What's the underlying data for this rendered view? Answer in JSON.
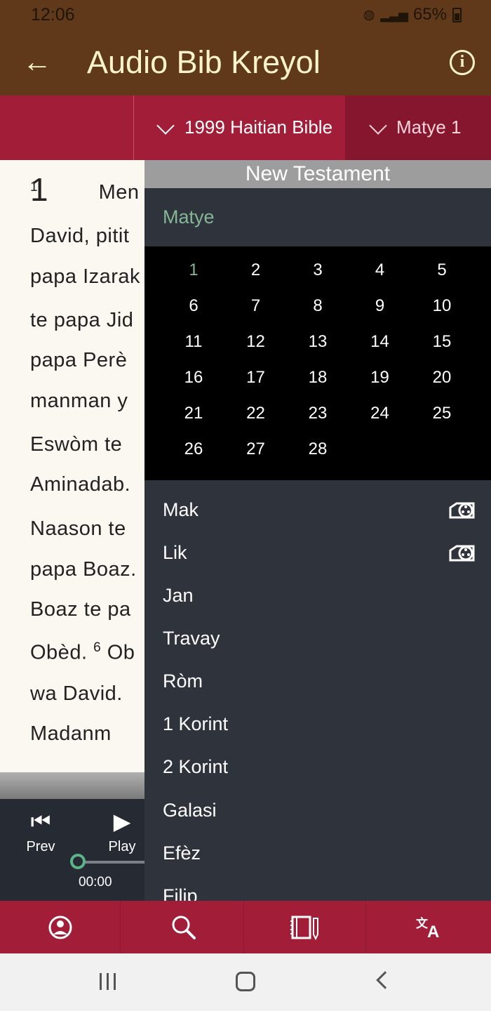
{
  "status_bar": {
    "time": "12:06",
    "battery": "65%",
    "wifi_icon": "wifi-icon",
    "signal_icon": "signal-icon",
    "battery_icon": "battery-icon"
  },
  "app_bar": {
    "title": "Audio Bib Kreyol",
    "back_icon": "back-arrow-icon",
    "info_icon": "info-icon",
    "background": "#60391a",
    "text_color": "#fff4cc"
  },
  "selectors": {
    "version": "1999 Haitian Bible",
    "book_chapter": "Matye 1",
    "background": "#a11d38"
  },
  "reader": {
    "chapter_number": "1",
    "verse_number": "1",
    "first_line": "Men n",
    "lines": [
      "David, pitit",
      "papa Izarak",
      "te papa Jid",
      "papa Perè",
      "manman y",
      "Eswòm te",
      "Aminadab.",
      "Naason te",
      "papa Boaz.",
      "Boaz te pa"
    ],
    "verse_six_start": "Obèd.",
    "verse_six_number": "6",
    "verse_six_continuation": "Ob",
    "final_lines": [
      "wa David.",
      "Madanm"
    ]
  },
  "player": {
    "prev_label": "Prev",
    "play_label": "Play",
    "time": "00:00",
    "progress": 0,
    "accent": "#5cb489"
  },
  "drawer": {
    "heading": "New Testament",
    "current_book": "Matye",
    "active_chapter": "1",
    "chapters": [
      "1",
      "2",
      "3",
      "4",
      "5",
      "6",
      "7",
      "8",
      "9",
      "10",
      "11",
      "12",
      "13",
      "14",
      "15",
      "16",
      "17",
      "18",
      "19",
      "20",
      "21",
      "22",
      "23",
      "24",
      "25",
      "26",
      "27",
      "28"
    ],
    "books": [
      {
        "label": "Mak",
        "icon": "film-reel-icon"
      },
      {
        "label": "Lik",
        "icon": "film-reel-icon"
      },
      {
        "label": "Jan"
      },
      {
        "label": "Travay"
      },
      {
        "label": "Ròm"
      },
      {
        "label": "1 Korint"
      },
      {
        "label": "2 Korint"
      },
      {
        "label": "Galasi"
      },
      {
        "label": "Efèz"
      },
      {
        "label": "Filip"
      }
    ]
  },
  "bottom_navigation": {
    "items": [
      "profile-icon",
      "search-icon",
      "notebook-pen-icon",
      "translate-icon"
    ]
  },
  "system_navigation": {
    "items": [
      "recent-apps-icon",
      "home-icon",
      "back-icon"
    ]
  }
}
